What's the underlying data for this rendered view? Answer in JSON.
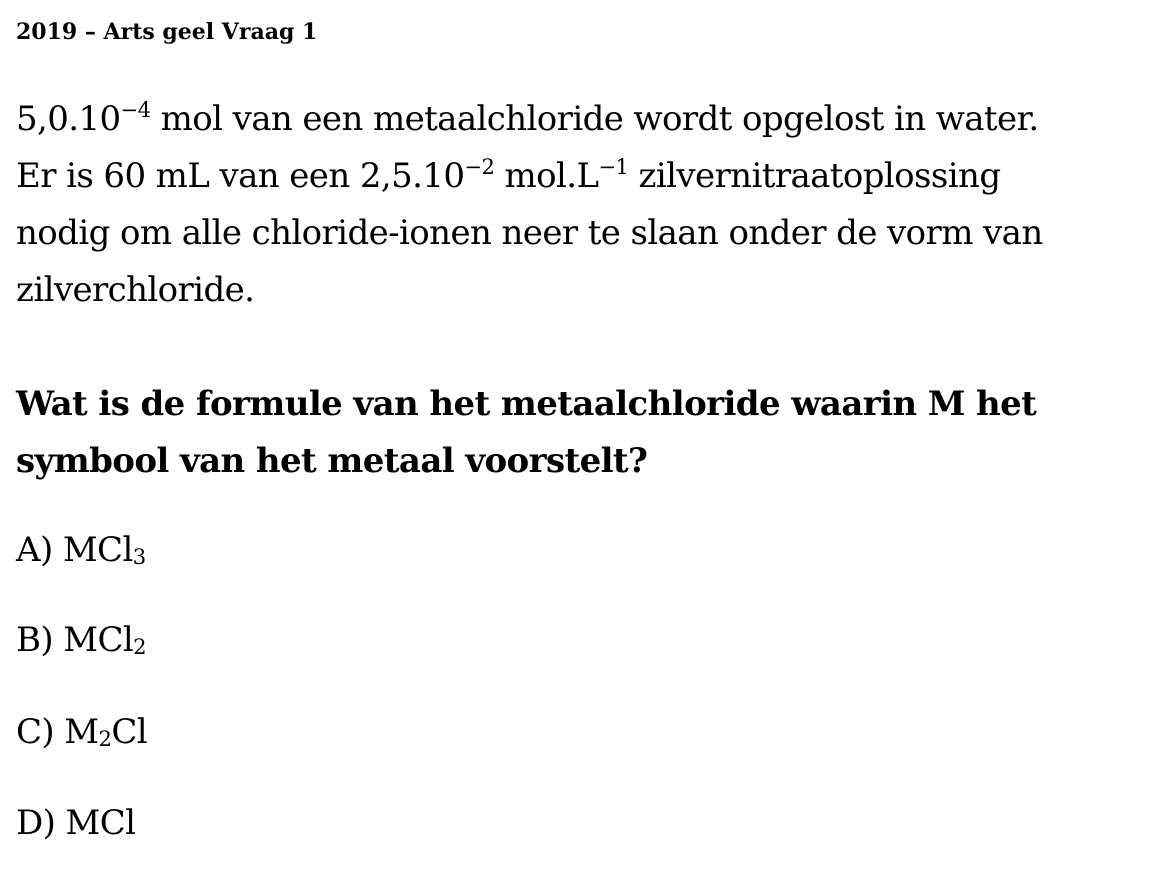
{
  "header": {
    "title": "2019 – Arts geel Vraag 1"
  },
  "stem": {
    "line1": {
      "pre": "5,0.10",
      "exp": "−4",
      "post": " mol van een metaalchloride wordt opgelost in water."
    },
    "line2": {
      "pre": "Er is 60 mL van een 2,5.10",
      "exp1": "−2",
      "mid": " mol.L",
      "exp2": "−1",
      "post": " zilvernitraatoplossing"
    },
    "line3": "nodig om alle chloride-ionen neer te slaan onder de vorm van",
    "line4": "zilverchloride."
  },
  "question": {
    "line1": "Wat is de formule van het metaalchloride waarin M het",
    "line2": "symbool van het metaal voorstelt?"
  },
  "options": {
    "a": {
      "label": "A) MCl",
      "sub": "3",
      "suffix": ""
    },
    "b": {
      "label": "B) MCl",
      "sub": "2",
      "suffix": ""
    },
    "c": {
      "label": "C) M",
      "sub": "2",
      "suffix": "Cl"
    },
    "d": {
      "label": "D) MCl",
      "sub": "",
      "suffix": ""
    }
  }
}
